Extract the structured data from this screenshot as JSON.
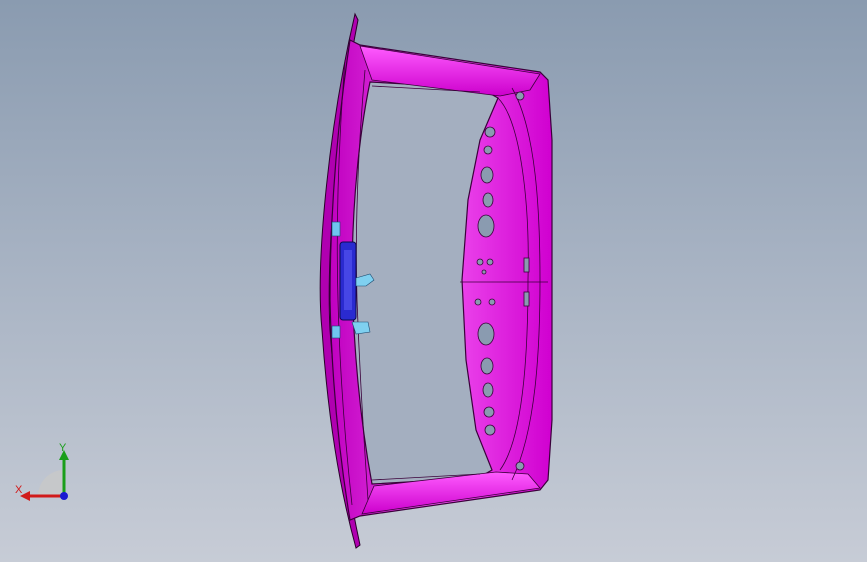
{
  "viewport": {
    "background_top": "#8a9bb0",
    "background_bottom": "#c7ccd6"
  },
  "model": {
    "part_color": "#e600e6",
    "part_highlight": "#f56af5",
    "part_edge": "#3a003a",
    "bracket_color": "#2222cc",
    "clip_color": "#7fd0f0"
  },
  "triad": {
    "x_label": "X",
    "y_label": "Y",
    "x_color": "#d11a1a",
    "y_color": "#1a9e1a",
    "z_color": "#1a1ad1"
  }
}
